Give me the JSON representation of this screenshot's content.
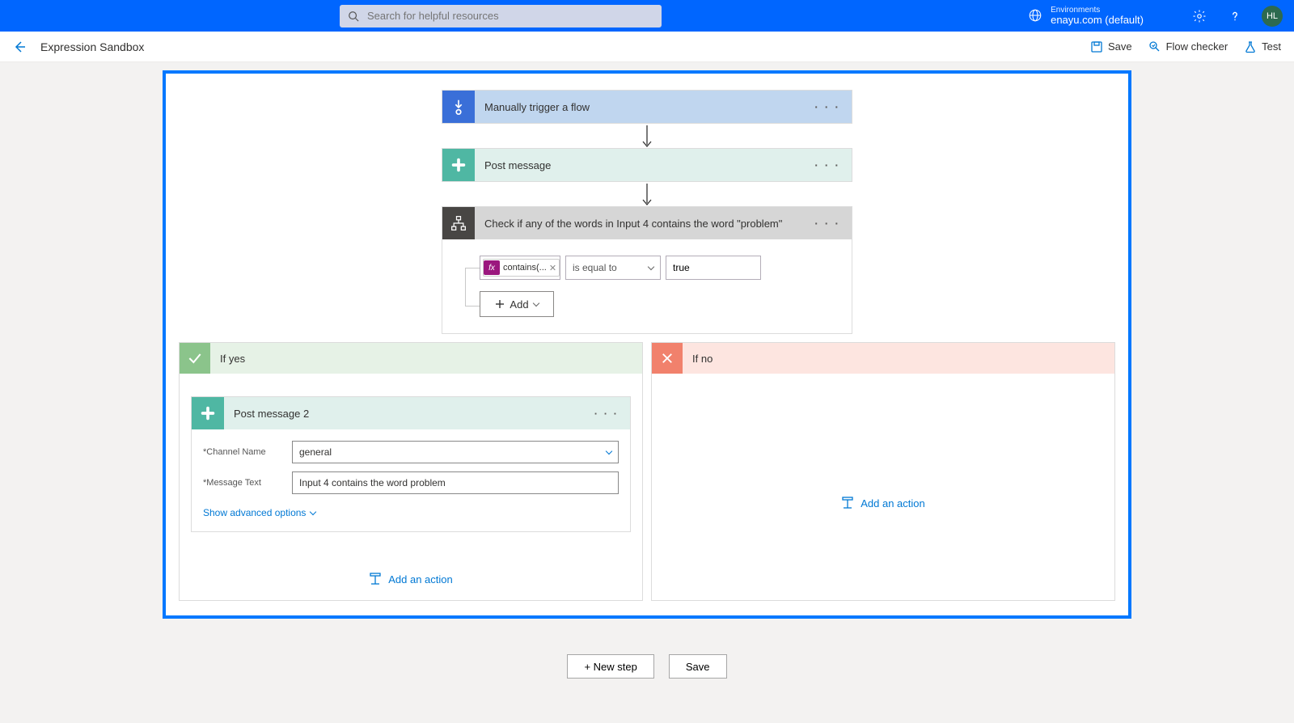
{
  "topbar": {
    "search_placeholder": "Search for helpful resources",
    "env_label": "Environments",
    "env_name": "enayu.com (default)",
    "avatar": "HL"
  },
  "secondbar": {
    "title": "Expression Sandbox",
    "save": "Save",
    "flowchecker": "Flow checker",
    "test": "Test"
  },
  "flow": {
    "trigger": "Manually trigger a flow",
    "post": "Post message",
    "condition_title": "Check if any of the words in Input 4 contains the word \"problem\"",
    "condition": {
      "token": "contains(...",
      "operator": "is equal to",
      "value": "true",
      "add": "Add"
    },
    "yes": {
      "title": "If yes",
      "pm2_title": "Post message 2",
      "channel_label": "Channel Name",
      "channel_value": "general",
      "message_label": "Message Text",
      "message_value": "Input 4 contains the word problem",
      "advanced": "Show advanced options",
      "add_action": "Add an action"
    },
    "no": {
      "title": "If no",
      "add_action": "Add an action"
    }
  },
  "bottom": {
    "newstep": "+ New step",
    "save": "Save"
  }
}
